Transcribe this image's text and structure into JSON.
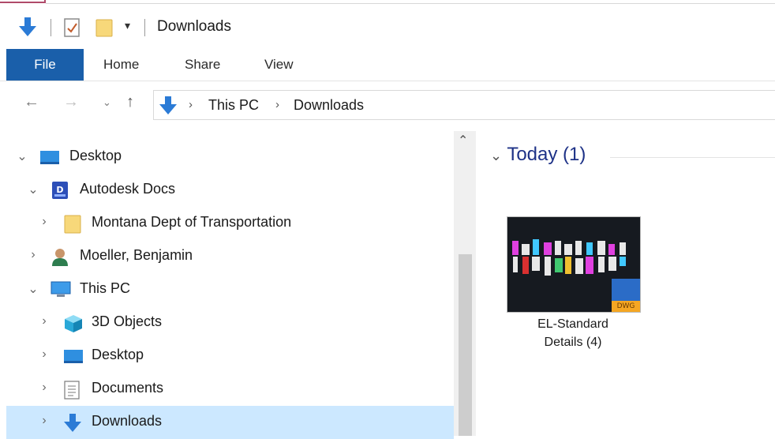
{
  "title_bar": {
    "title": "Downloads"
  },
  "ribbon": {
    "tabs": [
      {
        "label": "File"
      },
      {
        "label": "Home"
      },
      {
        "label": "Share"
      },
      {
        "label": "View"
      }
    ]
  },
  "address_bar": {
    "breadcrumbs": [
      "This PC",
      "Downloads"
    ],
    "separator": "›"
  },
  "nav_pane": {
    "items": [
      {
        "label": "Desktop",
        "icon": "desktop-icon",
        "expanded": true
      },
      {
        "label": "Autodesk Docs",
        "icon": "autodesk-docs-icon",
        "expanded": true
      },
      {
        "label": "Montana Dept of Transportation",
        "icon": "folder-icon",
        "expanded": false
      },
      {
        "label": "Moeller, Benjamin",
        "icon": "user-icon",
        "expanded": false
      },
      {
        "label": "This PC",
        "icon": "this-pc-icon",
        "expanded": true
      },
      {
        "label": "3D Objects",
        "icon": "3d-objects-icon",
        "expanded": false
      },
      {
        "label": "Desktop",
        "icon": "desktop-icon",
        "expanded": false
      },
      {
        "label": "Documents",
        "icon": "documents-icon",
        "expanded": false
      },
      {
        "label": "Downloads",
        "icon": "downloads-icon",
        "expanded": false,
        "selected": true
      }
    ]
  },
  "content": {
    "group_header": "Today (1)",
    "files": [
      {
        "name_line1": "EL-Standard",
        "name_line2": "Details (4)",
        "badge": "DWG"
      }
    ]
  },
  "colors": {
    "file_tab": "#1a5faa",
    "selected_row": "#cce8ff",
    "group_header": "#1e3287",
    "download_arrow": "#2b7bd6"
  }
}
